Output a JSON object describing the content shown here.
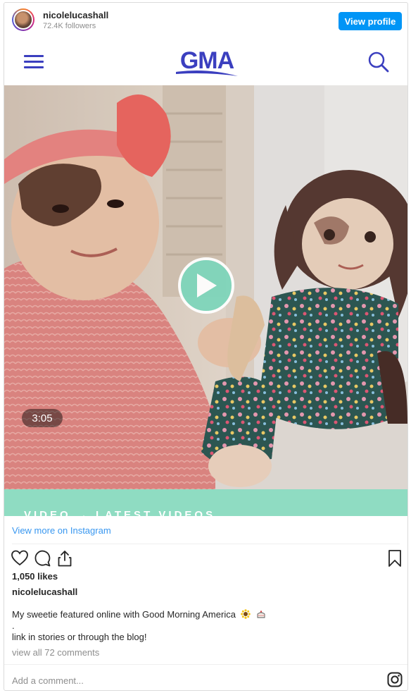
{
  "header": {
    "username": "nicolelucashall",
    "followers": "72.4K followers",
    "view_profile_label": "View profile"
  },
  "media": {
    "site_logo_text": "GMA",
    "video_duration": "3:05",
    "strip_text": "VIDEO → LATEST VIDEOS"
  },
  "links": {
    "view_more": "View more on Instagram"
  },
  "post": {
    "likes": "1,050 likes",
    "owner": "nicolelucashall",
    "caption_line1": "My sweetie featured online with Good Morning America",
    "caption_line2": ".",
    "caption_line3": "link in stories or through the blog!",
    "comments_link": "view all 72 comments"
  },
  "comment_input": {
    "placeholder": "Add a comment..."
  },
  "colors": {
    "accent_blue": "#0095f6",
    "link_blue": "#3897f0",
    "gma_blue": "#3b3fbf",
    "mint": "#8fdcc2"
  },
  "icons": [
    "hamburger-icon",
    "search-icon",
    "play-icon",
    "heart-icon",
    "comment-icon",
    "share-icon",
    "bookmark-icon",
    "instagram-icon"
  ]
}
